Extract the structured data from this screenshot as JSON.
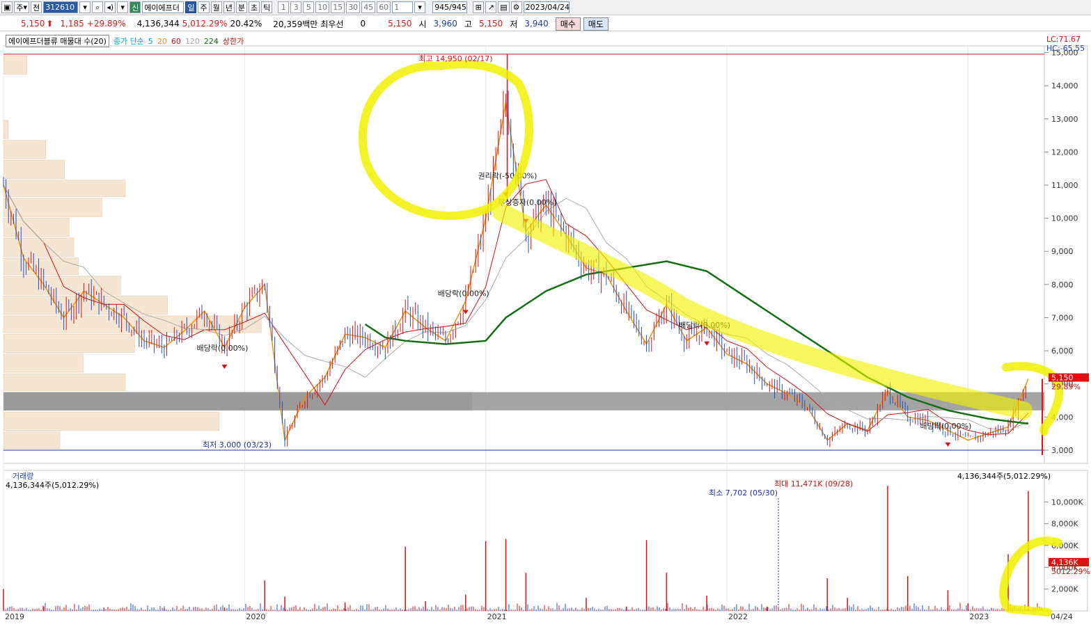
{
  "toolbar": {
    "period_select": "주",
    "prev_label": "전",
    "stock_code": "312610",
    "stock_name_badge": "신",
    "stock_name": "에이에프더",
    "period_buttons": [
      "일",
      "주",
      "월",
      "년",
      "분",
      "초",
      "틱"
    ],
    "active_period": "일",
    "interval_buttons": [
      "1",
      "3",
      "5",
      "10",
      "15",
      "30",
      "45",
      "60"
    ],
    "interval_select": "1",
    "count": "945/945",
    "date": "2023/04/24"
  },
  "infobar": {
    "price": "5,150",
    "change": "1,185",
    "change_pct": "+29.89%",
    "volume": "4,136,344",
    "volume_pct": "5,012.29%",
    "turnover": "20.42%",
    "amount": "20,359백만",
    "pref_label": "최우선",
    "pref_value": "0",
    "ask": "5,150",
    "open_label": "시",
    "open": "3,960",
    "high_label": "고",
    "high": "5,150",
    "low_label": "저",
    "low": "3,940",
    "buy_label": "매수",
    "sell_label": "매도"
  },
  "legend": {
    "indicator": "에이에프더블류 매물대 수(20)",
    "ma_label": "종가 단순",
    "ma_periods": [
      "5",
      "20",
      "60",
      "120",
      "224"
    ],
    "ma_colors": [
      "#00a6c8",
      "#f09000",
      "#d01010",
      "#aaaaaa",
      "#107010"
    ],
    "limit_label": "상한가"
  },
  "price_panel": {
    "lc": "LC:71.67",
    "hc": "HC:-65.55",
    "high_marker": "최고 14,950 (02/17)",
    "low_marker": "최저 3,000 (03/23)",
    "current_tag": "5,150",
    "current_pct_tag": "29.89%",
    "events": [
      {
        "label": "권리락(-50.00%)",
        "date": "2021-02",
        "price": 11200
      },
      {
        "label": "무상증자(0.00%)",
        "date": "2021-03",
        "price": 10400
      },
      {
        "label": "배당락(0.00%)",
        "date": "2020-12",
        "price": 7650
      },
      {
        "label": "배당락(0.00%)",
        "date": "2019-12",
        "price": 6000
      },
      {
        "label": "배당락(0.00%)",
        "date": "2021-12",
        "price": 6700
      },
      {
        "label": "배당락(0.00%)",
        "date": "2022-12",
        "price": 3650
      }
    ]
  },
  "volume_panel": {
    "title": "거래량",
    "current": "4,136,344주(5,012.29%)",
    "current_right": "4,136,344주(5,012.29%)",
    "max_marker": "최대 11,471K (09/28)",
    "min_marker": "최소 7,702 (05/30)",
    "current_tag": "4,136K",
    "current_pct_tag": "5012.29%"
  },
  "chart_data": {
    "type": "candlestick",
    "price_axis": {
      "ticks": [
        "3,000",
        "4,000",
        "5,000",
        "6,000",
        "7,000",
        "8,000",
        "9,000",
        "10,000",
        "11,000",
        "12,000",
        "13,000",
        "14,000",
        "15,000"
      ],
      "range": [
        2600,
        15200
      ]
    },
    "volume_axis": {
      "ticks": [
        "2,000K",
        "4,000K",
        "6,000K",
        "8,000K",
        "10,000K"
      ],
      "range": [
        0,
        12000000
      ]
    },
    "time_axis": {
      "ticks": [
        "2019",
        "2020",
        "2021",
        "2022",
        "2023",
        "04/24"
      ]
    },
    "close_series": [
      {
        "date": "2019-01",
        "close": 11000
      },
      {
        "date": "2019-02",
        "close": 8800
      },
      {
        "date": "2019-03",
        "close": 8000
      },
      {
        "date": "2019-04",
        "close": 7000
      },
      {
        "date": "2019-05",
        "close": 7800
      },
      {
        "date": "2019-06",
        "close": 7400
      },
      {
        "date": "2019-07",
        "close": 7000
      },
      {
        "date": "2019-08",
        "close": 6300
      },
      {
        "date": "2019-09",
        "close": 6100
      },
      {
        "date": "2019-10",
        "close": 6600
      },
      {
        "date": "2019-11",
        "close": 7200
      },
      {
        "date": "2019-12",
        "close": 6100
      },
      {
        "date": "2020-01",
        "close": 7300
      },
      {
        "date": "2020-02",
        "close": 8000
      },
      {
        "date": "2020-03",
        "close": 3300
      },
      {
        "date": "2020-04",
        "close": 4600
      },
      {
        "date": "2020-05",
        "close": 5200
      },
      {
        "date": "2020-06",
        "close": 6500
      },
      {
        "date": "2020-07",
        "close": 6400
      },
      {
        "date": "2020-08",
        "close": 6100
      },
      {
        "date": "2020-09",
        "close": 7200
      },
      {
        "date": "2020-10",
        "close": 6700
      },
      {
        "date": "2020-11",
        "close": 6300
      },
      {
        "date": "2020-12",
        "close": 7500
      },
      {
        "date": "2021-01",
        "close": 10000
      },
      {
        "date": "2021-02",
        "close": 13500
      },
      {
        "date": "2021-03",
        "close": 9600
      },
      {
        "date": "2021-04",
        "close": 10400
      },
      {
        "date": "2021-05",
        "close": 9500
      },
      {
        "date": "2021-06",
        "close": 8500
      },
      {
        "date": "2021-07",
        "close": 8300
      },
      {
        "date": "2021-08",
        "close": 7200
      },
      {
        "date": "2021-09",
        "close": 6200
      },
      {
        "date": "2021-10",
        "close": 7400
      },
      {
        "date": "2021-11",
        "close": 6300
      },
      {
        "date": "2021-12",
        "close": 6700
      },
      {
        "date": "2022-01",
        "close": 5900
      },
      {
        "date": "2022-02",
        "close": 5600
      },
      {
        "date": "2022-03",
        "close": 5000
      },
      {
        "date": "2022-04",
        "close": 4700
      },
      {
        "date": "2022-05",
        "close": 4300
      },
      {
        "date": "2022-06",
        "close": 3300
      },
      {
        "date": "2022-07",
        "close": 3800
      },
      {
        "date": "2022-08",
        "close": 3600
      },
      {
        "date": "2022-09",
        "close": 4800
      },
      {
        "date": "2022-10",
        "close": 4000
      },
      {
        "date": "2022-11",
        "close": 3900
      },
      {
        "date": "2022-12",
        "close": 3600
      },
      {
        "date": "2023-01",
        "close": 3300
      },
      {
        "date": "2023-02",
        "close": 3500
      },
      {
        "date": "2023-03",
        "close": 3700
      },
      {
        "date": "2023-04",
        "close": 5150
      }
    ],
    "ma224_series": [
      {
        "date": "2020-07",
        "value": 6800
      },
      {
        "date": "2020-08",
        "value": 6400
      },
      {
        "date": "2020-09",
        "value": 6300
      },
      {
        "date": "2020-11",
        "value": 6200
      },
      {
        "date": "2021-01",
        "value": 6300
      },
      {
        "date": "2021-02",
        "value": 7000
      },
      {
        "date": "2021-04",
        "value": 7800
      },
      {
        "date": "2021-06",
        "value": 8300
      },
      {
        "date": "2021-08",
        "value": 8500
      },
      {
        "date": "2021-10",
        "value": 8700
      },
      {
        "date": "2021-12",
        "value": 8400
      },
      {
        "date": "2022-02",
        "value": 7600
      },
      {
        "date": "2022-04",
        "value": 6800
      },
      {
        "date": "2022-06",
        "value": 6000
      },
      {
        "date": "2022-08",
        "value": 5200
      },
      {
        "date": "2022-10",
        "value": 4600
      },
      {
        "date": "2022-12",
        "value": 4200
      },
      {
        "date": "2023-02",
        "value": 3950
      },
      {
        "date": "2023-04",
        "value": 3800
      }
    ],
    "volume_profile_bands": [
      {
        "price_low": 14350,
        "price_high": 14900,
        "relative": 0.05
      },
      {
        "price_low": 12400,
        "price_high": 12950,
        "relative": 0.01
      },
      {
        "price_low": 11800,
        "price_high": 12350,
        "relative": 0.09
      },
      {
        "price_low": 11200,
        "price_high": 11750,
        "relative": 0.13
      },
      {
        "price_low": 10650,
        "price_high": 11150,
        "relative": 0.26
      },
      {
        "price_low": 10050,
        "price_high": 10600,
        "relative": 0.21
      },
      {
        "price_low": 9450,
        "price_high": 10000,
        "relative": 0.14
      },
      {
        "price_low": 8850,
        "price_high": 9400,
        "relative": 0.15
      },
      {
        "price_low": 8300,
        "price_high": 8800,
        "relative": 0.16
      },
      {
        "price_low": 7700,
        "price_high": 8250,
        "relative": 0.25
      },
      {
        "price_low": 7100,
        "price_high": 7650,
        "relative": 0.35
      },
      {
        "price_low": 6550,
        "price_high": 7050,
        "relative": 0.55
      },
      {
        "price_low": 5950,
        "price_high": 6500,
        "relative": 0.28
      },
      {
        "price_low": 5350,
        "price_high": 5900,
        "relative": 0.17
      },
      {
        "price_low": 4800,
        "price_high": 5300,
        "relative": 0.26
      },
      {
        "price_low": 4200,
        "price_high": 4750,
        "relative": 1.0,
        "highlight": true
      },
      {
        "price_low": 3600,
        "price_high": 4150,
        "relative": 0.46
      },
      {
        "price_low": 3050,
        "price_high": 3550,
        "relative": 0.12
      }
    ],
    "volume_series": [
      {
        "date": "2019-01",
        "value": 2000000
      },
      {
        "date": "2019-03",
        "value": 400000
      },
      {
        "date": "2019-06",
        "value": 300000
      },
      {
        "date": "2019-09",
        "value": 250000
      },
      {
        "date": "2019-12",
        "value": 300000
      },
      {
        "date": "2020-02",
        "value": 2800000
      },
      {
        "date": "2020-03",
        "value": 1300000
      },
      {
        "date": "2020-06",
        "value": 800000
      },
      {
        "date": "2020-09",
        "value": 5900000
      },
      {
        "date": "2020-10",
        "value": 900000
      },
      {
        "date": "2020-12",
        "value": 1500000
      },
      {
        "date": "2021-01",
        "value": 6400000
      },
      {
        "date": "2021-02",
        "value": 6600000
      },
      {
        "date": "2021-03",
        "value": 3500000
      },
      {
        "date": "2021-06",
        "value": 1200000
      },
      {
        "date": "2021-08",
        "value": 400000
      },
      {
        "date": "2021-09",
        "value": 6500000
      },
      {
        "date": "2021-10",
        "value": 3500000
      },
      {
        "date": "2021-12",
        "value": 1400000
      },
      {
        "date": "2022-03",
        "value": 400000
      },
      {
        "date": "2022-06",
        "value": 3000000
      },
      {
        "date": "2022-07",
        "value": 1200000
      },
      {
        "date": "2022-09",
        "value": 11471000
      },
      {
        "date": "2022-10",
        "value": 3200000
      },
      {
        "date": "2022-12",
        "value": 1900000
      },
      {
        "date": "2023-01",
        "value": 700000
      },
      {
        "date": "2023-03",
        "value": 5200000
      },
      {
        "date": "2023-04",
        "value": 11000000
      }
    ]
  }
}
